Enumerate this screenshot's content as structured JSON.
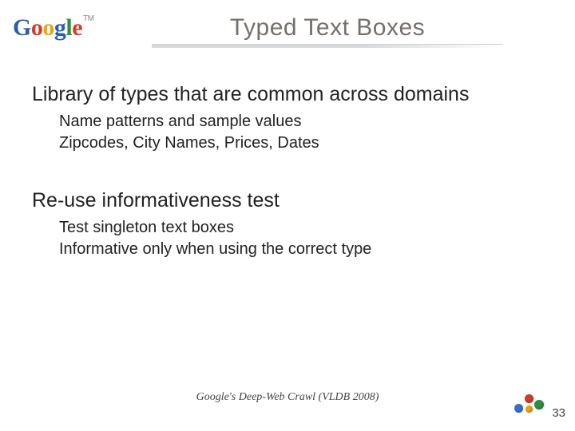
{
  "header": {
    "title": "Typed Text Boxes",
    "logo_text": "Google"
  },
  "content": {
    "section1": {
      "heading": "Library of types that are common across domains",
      "lines": [
        "Name patterns and sample values",
        "Zipcodes, City Names, Prices, Dates"
      ]
    },
    "section2": {
      "heading": "Re-use informativeness test",
      "lines": [
        "Test singleton text boxes",
        "Informative only when using the correct type"
      ]
    }
  },
  "footer": {
    "citation": "Google's Deep-Web Crawl (VLDB 2008)",
    "page_number": "33"
  }
}
